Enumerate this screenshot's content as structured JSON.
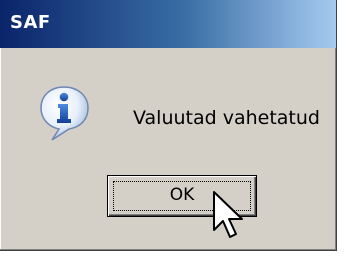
{
  "window": {
    "title": "SAF"
  },
  "dialog": {
    "icon": "information-icon",
    "message": "Valuutad vahetatud",
    "ok_label": "OK"
  },
  "cursor": {
    "icon": "mouse-pointer-icon"
  },
  "colors": {
    "titlebar_start": "#0a246a",
    "titlebar_end": "#a6caf0",
    "dialog_bg": "#d4d0c8",
    "icon_blue": "#1f5fbf"
  }
}
